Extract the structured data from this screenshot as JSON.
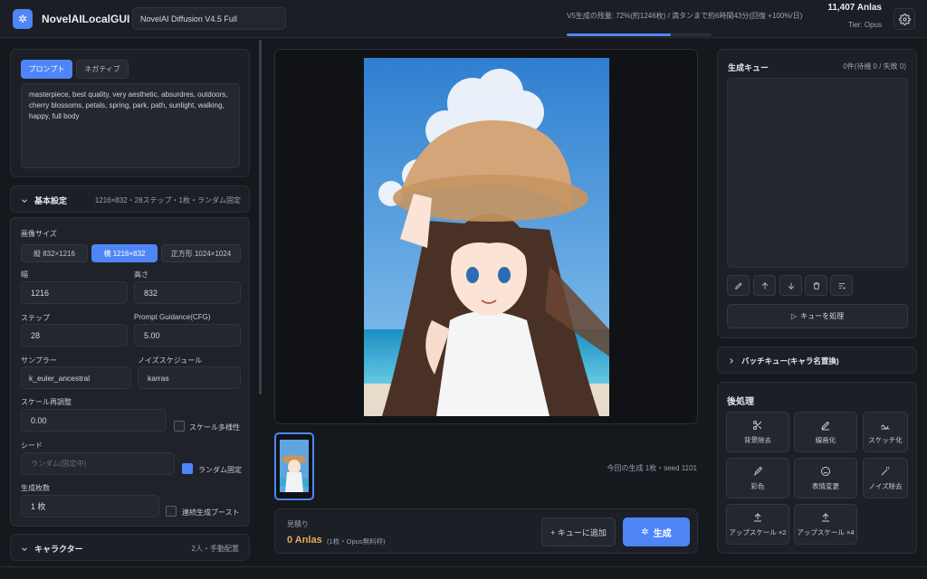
{
  "app": {
    "title": "NovelAILocalGUI",
    "model": "NovelAI Diffusion V4.5 Full"
  },
  "header": {
    "anlas_status": "V5生成の残量: 72%(約1246枚) / 満タンまで約6時間43分(回復 +100%/日)",
    "anlas_progress": 0.72,
    "anlas_total": "11,407 Anlas",
    "tier": "Tier: Opus"
  },
  "prompt": {
    "tabs": [
      "プロンプト",
      "ネガティブ"
    ],
    "text": "masterpiece, best quality, very aesthetic, absurdres, outdoors, cherry blossoms, petals, spring, park, path, sunlight, walking, happy, full body"
  },
  "basic": {
    "title": "基本設定",
    "summary": "1216×832・28ステップ・1枚・ランダム固定",
    "image_size_label": "画像サイズ",
    "sizes": [
      "縦 832×1216",
      "横 1216×832",
      "正方形 1024×1024"
    ],
    "width_label": "幅",
    "width": "1216",
    "height_label": "高さ",
    "height": "832",
    "steps_label": "ステップ",
    "steps": "28",
    "cfg_label": "Prompt Guidance(CFG)",
    "cfg": "5.00",
    "sampler_label": "サンプラー",
    "sampler": "k_euler_ancestral",
    "noise_label": "ノイズスケジュール",
    "noise": "karras",
    "rescale_label": "スケール再調整",
    "rescale": "0.00",
    "variety_label": "スケール多様性",
    "seed_label": "シード",
    "seed_placeholder": "ランダム(固定中)",
    "random_fixed_label": "ランダム固定",
    "count_label": "生成枚数",
    "count": "1 枚",
    "boost_label": "連続生成ブースト"
  },
  "character": {
    "title": "キャラクター",
    "summary": "2人・手動配置"
  },
  "center": {
    "gen_info": "今回の生成 1枚・seed 1101",
    "estimate_label": "見積り",
    "estimate_value": "0 Anlas",
    "estimate_note": "(1枚・Opus無料枠)",
    "add_queue": "+ キューに追加",
    "generate": "生成"
  },
  "queue": {
    "title": "生成キュー",
    "count": "0件(待機 0 / 失敗 0)",
    "process": "キューを処理",
    "batch_title": "バッチキュー(キャラ名置換)"
  },
  "post": {
    "title": "後処理",
    "items": [
      "背景除去",
      "線画化",
      "スケッチ化",
      "彩色",
      "表情変更",
      "ノイズ除去",
      "アップスケール ×2",
      "アップスケール ×4"
    ]
  },
  "colors": {
    "accent": "#4f86f7",
    "estimate": "#e8a95a",
    "bg": "#15181d"
  }
}
